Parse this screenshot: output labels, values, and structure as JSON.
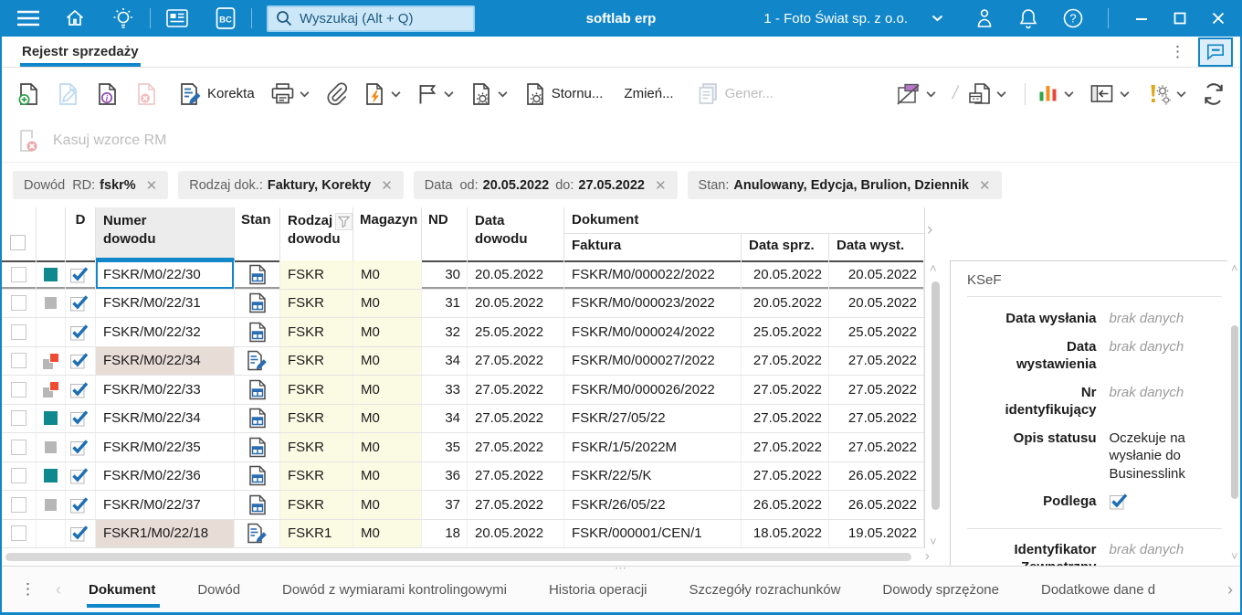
{
  "topbar": {
    "search_placeholder": "Wyszukaj (Alt + Q)",
    "app_title": "softlab erp",
    "company": "1 - Foto Świat sp. z o.o."
  },
  "tabs": {
    "main": "Rejestr sprzedaży"
  },
  "toolbar": {
    "korekta": "Korekta",
    "stornuj": "Stornu...",
    "zmien": "Zmień...",
    "generuj": "Gener...",
    "kasuj_wzorce": "Kasuj wzorce RM"
  },
  "filters": {
    "chip1_label": "Dowód  RD:",
    "chip1_value": "fskr%",
    "chip2_label": "Rodzaj dok.:",
    "chip2_value": "Faktury, Korekty",
    "chip3_label": "Data  od:",
    "chip3_value1": "20.05.2022",
    "chip3_label2": "do:",
    "chip3_value2": "27.05.2022",
    "chip4_label": "Stan:",
    "chip4_value": "Anulowany, Edycja, Brulion, Dziennik"
  },
  "table": {
    "headers": {
      "d": "D",
      "numer_line1": "Numer",
      "numer_line2": "dowodu",
      "stan": "Stan",
      "rodzaj_line1": "Rodzaj",
      "rodzaj_line2": "dowodu",
      "magazyn": "Magazyn",
      "nd": "ND",
      "data_line1": "Data",
      "data_line2": "dowodu",
      "dokument": "Dokument",
      "faktura": "Faktura",
      "data_sprz": "Data sprz.",
      "data_wyst": "Data wyst."
    },
    "rows": [
      {
        "indicator": "teal",
        "d_checked": true,
        "numer": "FSKR/M0/22/30",
        "stan": "document",
        "rodzaj": "FSKR",
        "magazyn": "M0",
        "nd": "30",
        "data_dowodu": "20.05.2022",
        "faktura": "FSKR/M0/000022/2022",
        "data_sprz": "20.05.2022",
        "data_wyst": "20.05.2022",
        "selected": true,
        "numer_bg": "none"
      },
      {
        "indicator": "gray",
        "d_checked": true,
        "numer": "FSKR/M0/22/31",
        "stan": "document",
        "rodzaj": "FSKR",
        "magazyn": "M0",
        "nd": "31",
        "data_dowodu": "20.05.2022",
        "faktura": "FSKR/M0/000023/2022",
        "data_sprz": "20.05.2022",
        "data_wyst": "20.05.2022",
        "selected": false,
        "numer_bg": "none"
      },
      {
        "indicator": "none",
        "d_checked": true,
        "numer": "FSKR/M0/22/32",
        "stan": "document",
        "rodzaj": "FSKR",
        "magazyn": "M0",
        "nd": "32",
        "data_dowodu": "25.05.2022",
        "faktura": "FSKR/M0/000024/2022",
        "data_sprz": "25.05.2022",
        "data_wyst": "25.05.2022",
        "selected": false,
        "numer_bg": "none"
      },
      {
        "indicator": "gray-red",
        "d_checked": true,
        "numer": "FSKR/M0/22/34",
        "stan": "edit",
        "rodzaj": "FSKR",
        "magazyn": "M0",
        "nd": "34",
        "data_dowodu": "27.05.2022",
        "faktura": "FSKR/M0/000027/2022",
        "data_sprz": "27.05.2022",
        "data_wyst": "27.05.2022",
        "selected": false,
        "numer_bg": "pink"
      },
      {
        "indicator": "gray-red",
        "d_checked": true,
        "numer": "FSKR/M0/22/33",
        "stan": "document",
        "rodzaj": "FSKR",
        "magazyn": "M0",
        "nd": "33",
        "data_dowodu": "27.05.2022",
        "faktura": "FSKR/M0/000026/2022",
        "data_sprz": "27.05.2022",
        "data_wyst": "27.05.2022",
        "selected": false,
        "numer_bg": "none"
      },
      {
        "indicator": "teal",
        "d_checked": true,
        "numer": "FSKR/M0/22/34",
        "stan": "document",
        "rodzaj": "FSKR",
        "magazyn": "M0",
        "nd": "34",
        "data_dowodu": "27.05.2022",
        "faktura": "FSKR/27/05/22",
        "data_sprz": "27.05.2022",
        "data_wyst": "27.05.2022",
        "selected": false,
        "numer_bg": "none"
      },
      {
        "indicator": "gray",
        "d_checked": true,
        "numer": "FSKR/M0/22/35",
        "stan": "document",
        "rodzaj": "FSKR",
        "magazyn": "M0",
        "nd": "35",
        "data_dowodu": "27.05.2022",
        "faktura": "FSKR/1/5/2022M",
        "data_sprz": "27.05.2022",
        "data_wyst": "27.05.2022",
        "selected": false,
        "numer_bg": "none"
      },
      {
        "indicator": "teal",
        "d_checked": true,
        "numer": "FSKR/M0/22/36",
        "stan": "document",
        "rodzaj": "FSKR",
        "magazyn": "M0",
        "nd": "36",
        "data_dowodu": "27.05.2022",
        "faktura": "FSKR/22/5/K",
        "data_sprz": "27.05.2022",
        "data_wyst": "26.05.2022",
        "selected": false,
        "numer_bg": "none"
      },
      {
        "indicator": "gray",
        "d_checked": true,
        "numer": "FSKR/M0/22/37",
        "stan": "document",
        "rodzaj": "FSKR",
        "magazyn": "M0",
        "nd": "37",
        "data_dowodu": "27.05.2022",
        "faktura": "FSKR/26/05/22",
        "data_sprz": "26.05.2022",
        "data_wyst": "26.05.2022",
        "selected": false,
        "numer_bg": "none"
      },
      {
        "indicator": "none",
        "d_checked": true,
        "numer": "FSKR1/M0/22/18",
        "stan": "edit",
        "rodzaj": "FSKR1",
        "magazyn": "M0",
        "nd": "18",
        "data_dowodu": "20.05.2022",
        "faktura": "FSKR/000001/CEN/1",
        "data_sprz": "18.05.2022",
        "data_wyst": "19.05.2022",
        "selected": false,
        "numer_bg": "pink"
      }
    ]
  },
  "ksef": {
    "title": "KSeF",
    "fields": [
      {
        "label": "Data wysłania",
        "value": "brak danych",
        "type": "empty"
      },
      {
        "label": "Data wystawienia",
        "value": "brak danych",
        "type": "empty"
      },
      {
        "label": "Nr identyfikujący",
        "value": "brak danych",
        "type": "empty"
      },
      {
        "label": "Opis statusu",
        "value": "Oczekuje na wysłanie do Businesslink",
        "type": "text"
      },
      {
        "label": "Podlega",
        "value": "checked",
        "type": "checkbox"
      },
      {
        "label": "Identyfikator Zewnętrzny",
        "value": "brak danych",
        "type": "empty",
        "divider_above": true
      }
    ]
  },
  "bottom_tabs": {
    "items": [
      {
        "label": "Dokument",
        "active": true
      },
      {
        "label": "Dowód",
        "active": false
      },
      {
        "label": "Dowód z wymiarami kontrolingowymi",
        "active": false
      },
      {
        "label": "Historia operacji",
        "active": false
      },
      {
        "label": "Szczegóły rozrachunków",
        "active": false
      },
      {
        "label": "Dowody sprzężone",
        "active": false
      },
      {
        "label": "Dodatkowe dane d",
        "active": false
      }
    ]
  },
  "colors": {
    "topbar_blue": "#1186c9",
    "accent_blue": "#1186c9",
    "teal_indicator": "#10898e",
    "red_indicator": "#ee4b33",
    "gray_indicator": "#b7b7b7",
    "yellow_column": "#fbfbe4",
    "pink_cell": "#e8dcd7"
  }
}
